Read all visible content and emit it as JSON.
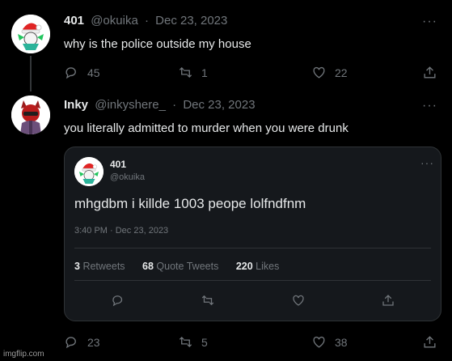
{
  "tweet1": {
    "display_name": "401",
    "handle": "@okuika",
    "separator": "·",
    "date": "Dec 23, 2023",
    "text": "why is the police outside my house",
    "replies": "45",
    "retweets": "1",
    "likes": "22"
  },
  "tweet2": {
    "display_name": "Inky",
    "handle": "@inkyshere_",
    "separator": "·",
    "date": "Dec 23, 2023",
    "text": "you literally admitted to murder when you were drunk",
    "replies": "23",
    "retweets": "5",
    "likes": "38"
  },
  "quoted": {
    "display_name": "401",
    "handle": "@okuika",
    "text": "mhgdbm i killde 1003 peope lolfndfnm",
    "timestamp": "3:40 PM · Dec 23, 2023",
    "retweets_count": "3",
    "retweets_label": "Retweets",
    "quote_tweets_count": "68",
    "quote_tweets_label": "Quote Tweets",
    "likes_count": "220",
    "likes_label": "Likes"
  },
  "more_glyph": "···",
  "watermark": "imgflip.com",
  "colors": {
    "background": "#000000",
    "text": "#e7e9ea",
    "muted": "#71767b",
    "card": "#15181c",
    "border": "#2f3336"
  },
  "icons": [
    "reply-icon",
    "retweet-icon",
    "like-icon",
    "share-icon",
    "more-icon"
  ]
}
